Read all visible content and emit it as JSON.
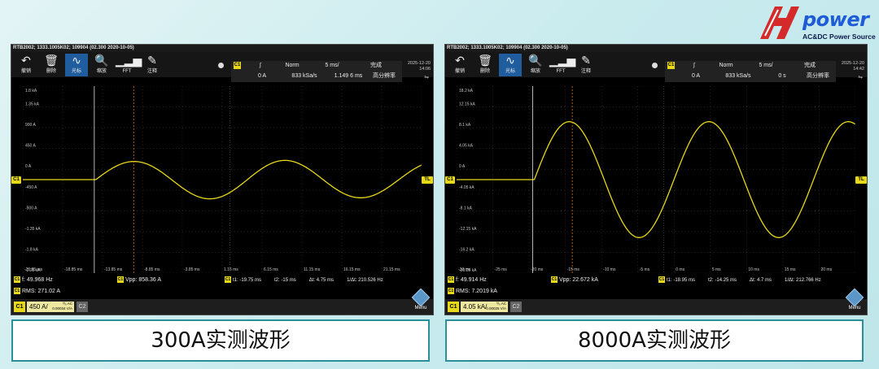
{
  "brand": {
    "logo_text": "power",
    "logo_subtitle": "AC&DC Power Source"
  },
  "colors": {
    "trace": "#e8d81a",
    "active_tool": "#1f5d9e",
    "caption_border": "#2a8f99",
    "background": "#c9ebee"
  },
  "toolbar_items": [
    {
      "icon": "undo-icon",
      "glyph": "↶",
      "label": "撤销"
    },
    {
      "icon": "trash-icon",
      "glyph": "🗑",
      "label": "删除"
    },
    {
      "icon": "sine-wave-icon",
      "glyph": "∿",
      "label": "光标"
    },
    {
      "icon": "zoom-icon",
      "glyph": "🔍",
      "label": "缩放"
    },
    {
      "icon": "fft-icon",
      "glyph": "▁▂▅",
      "label": "FFT"
    },
    {
      "icon": "pen-icon",
      "glyph": "✎",
      "label": "注释"
    }
  ],
  "scopes": [
    {
      "title": "RTB2002; 1333.1005K02; 109904 (02.300 2020-10-05)",
      "trigger": {
        "channel": "C1",
        "slope": "∫",
        "mode": "Norm",
        "timebase": "5 ms/",
        "status": "完成",
        "level": "0 A",
        "sample_rate": "833 kSa/s",
        "position": "1.149 6 ms",
        "resolution": "高分辨率"
      },
      "datetime": {
        "date": "2025-12-20",
        "time": "14:06"
      },
      "y_labels": [
        "1.8 kA",
        "1.35 kA",
        "900 A",
        "450 A",
        "0 A",
        "-450 A",
        "-900 A",
        "-1.35 kA",
        "-1.8 kA",
        "-2.25 kA"
      ],
      "x_labels": [
        "-25.85 ms",
        "-18.85 ms",
        "-13.85 ms",
        "-8.85 ms",
        "-3.85 ms",
        "1.15 ms",
        "6.15 ms",
        "11.15 ms",
        "16.15 ms",
        "21.15 ms",
        "26.15 ms"
      ],
      "ch_marker": "C1",
      "tl_marker": "TL",
      "measurements": {
        "freq": "f: 49.968 Hz",
        "vpp": "Vpp: 858.36 A",
        "rms": "RMS: 271.02 A"
      },
      "cursors": {
        "t1": "t1: -19.75 ms",
        "t2": "t2: -15 ms",
        "dt": "Δt: 4.75 ms",
        "inv": "1/Δt: 210.526 Hz"
      },
      "bottom": {
        "ch1": "C1",
        "scale": "450 A/",
        "scale_sub1": "⁰/₀ AC",
        "scale_sub2": "0.00034 V/A",
        "ch2": "C2",
        "menu": "Menu"
      },
      "signal": {
        "start_fraction": 0.183,
        "amplitude_fraction": 0.1,
        "cycles": 2.15,
        "decay": 0.04
      }
    },
    {
      "title": "RTB2002; 1333.1005K02; 109904 (02.300 2020-10-05)",
      "trigger": {
        "channel": "C1",
        "slope": "∫",
        "mode": "Norm",
        "timebase": "5 ms/",
        "status": "完成",
        "level": "0 A",
        "sample_rate": "833 kSa/s",
        "position": "0 s",
        "resolution": "高分辨率"
      },
      "datetime": {
        "date": "2025-12-20",
        "time": "14:42"
      },
      "y_labels": [
        "18.2 kA",
        "12.15 kA",
        "8.1 kA",
        "4.05 kA",
        "0 A",
        "-4.05 kA",
        "-8.1 kA",
        "-12.15 kA",
        "-16.2 kA",
        "-20.25 kA"
      ],
      "x_labels": [
        "-30 ms",
        "-25 ms",
        "-20 ms",
        "-15 ms",
        "-10 ms",
        "-5 ms",
        "0 ms",
        "5 ms",
        "10 ms",
        "15 ms",
        "20 ms",
        "25 ms"
      ],
      "ch_marker": "C1",
      "tl_marker": "TL",
      "measurements": {
        "freq": "f: 49.914 Hz",
        "vpp": "Vpp: 22.672 kA",
        "rms": "RMS: 7.2019 kA"
      },
      "cursors": {
        "t1": "t1: -18.95 ms",
        "t2": "t2: -14.25 ms",
        "dt": "Δt: 4.7 ms",
        "inv": "1/Δt: 212.766 Hz"
      },
      "bottom": {
        "ch1": "C1",
        "scale": "4.05 kA/",
        "scale_sub1": "⁰/₀ AC",
        "scale_sub2": "0.00025 V/A",
        "ch2": "C2",
        "menu": "Menu"
      },
      "signal": {
        "start_fraction": 0.195,
        "amplitude_fraction": 0.31,
        "cycles": 2.3,
        "decay": 0.0
      }
    }
  ],
  "captions": [
    "300A实测波形",
    "8000A实测波形"
  ]
}
